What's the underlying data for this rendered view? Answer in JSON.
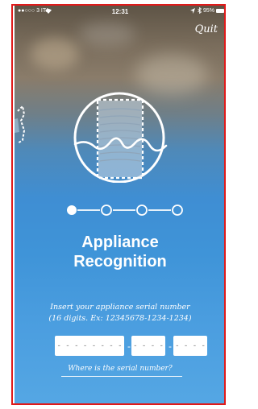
{
  "status_bar": {
    "carrier": "●●○○○ 3 ITA",
    "time": "12:31",
    "battery": "95%"
  },
  "header": {
    "quit_label": "Quit"
  },
  "stepper": {
    "total_steps": 4,
    "current_step": 1
  },
  "main": {
    "title_line1": "Appliance",
    "title_line2": "Recognition",
    "instruction_line1": "Insert your appliance serial number",
    "instruction_line2": "(16 digits. Ex: 12345678-1234-1234)"
  },
  "serial_form": {
    "field1_placeholder": "- - - - - - - -",
    "field2_placeholder": "- - - -",
    "field3_placeholder": "- - - -",
    "separator": "-"
  },
  "help": {
    "link_label": "Where is the serial number?"
  },
  "icons": {
    "wifi": "wifi-icon",
    "location": "location-arrow-icon",
    "bluetooth": "bluetooth-icon",
    "battery": "battery-icon",
    "camera_frame": "scan-frame-icon"
  }
}
